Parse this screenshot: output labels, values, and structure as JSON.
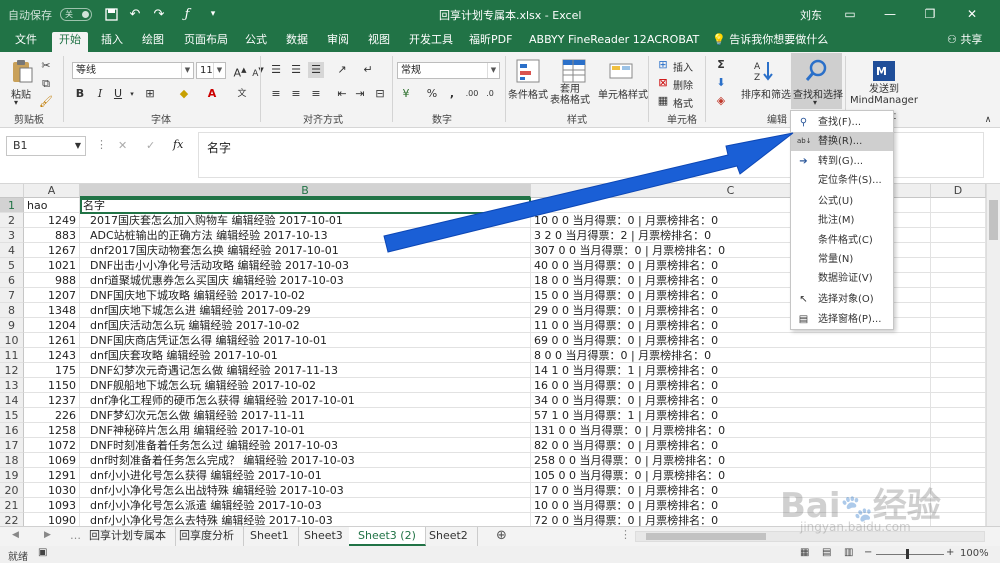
{
  "title_bar": {
    "autosave_label": "自动保存",
    "autosave_state": "关",
    "window_title": "回享计划专属本.xlsx - Excel",
    "user": "刘东",
    "share": "共享"
  },
  "tabs": [
    "文件",
    "开始",
    "插入",
    "绘图",
    "页面布局",
    "公式",
    "数据",
    "审阅",
    "视图",
    "开发工具",
    "福昕PDF",
    "ABBYY FineReader 12",
    "ACROBAT"
  ],
  "tell_me": "告诉我你想要做什么",
  "ribbon": {
    "clipboard": {
      "paste": "粘贴",
      "label": "剪贴板"
    },
    "font": {
      "name": "等线",
      "size": "11",
      "label": "字体"
    },
    "alignment": {
      "label": "对齐方式"
    },
    "number": {
      "format": "常规",
      "label": "数字"
    },
    "styles": {
      "conditional": "条件格式",
      "table": "套用\n表格格式",
      "cell": "单元格样式",
      "label": "样式"
    },
    "cells": {
      "insert": "插入",
      "delete": "删除",
      "format": "格式",
      "label": "单元格"
    },
    "editing": {
      "sort": "排序和筛选",
      "find": "查找和选择",
      "label": "编辑"
    },
    "mindmanager": {
      "send": "发送到\nMindManager",
      "label": "et"
    }
  },
  "formula_bar": {
    "name_box": "B1",
    "fx": "fx",
    "content": "名字"
  },
  "columns": [
    {
      "label": "A"
    },
    {
      "label": "B"
    },
    {
      "label": "C"
    },
    {
      "label": "D"
    }
  ],
  "rows": [
    {
      "n": "1",
      "a": "hao",
      "b": "名字",
      "c": "数据"
    },
    {
      "n": "2",
      "a": "1249",
      "b": "2017国庆套怎么加入购物车 编辑经验 2017-10-01",
      "c": "10 0 0 当月得票：0 | 月票榜排名：0"
    },
    {
      "n": "3",
      "a": "883",
      "b": "ADC站桩输出的正确方法 编辑经验 2017-10-13",
      "c": "3 2 0 当月得票：2 | 月票榜排名：0"
    },
    {
      "n": "4",
      "a": "1267",
      "b": "dnf2017国庆动物套怎么换 编辑经验 2017-10-01",
      "c": "307 0 0 当月得票：0 | 月票榜排名：0"
    },
    {
      "n": "5",
      "a": "1021",
      "b": "DNF出击小小净化号活动攻略 编辑经验 2017-10-03",
      "c": "40 0 0 当月得票：0 | 月票榜排名：0"
    },
    {
      "n": "6",
      "a": "988",
      "b": "dnf道聚城优惠券怎么买国庆 编辑经验 2017-10-03",
      "c": "18 0 0 当月得票：0 | 月票榜排名：0"
    },
    {
      "n": "7",
      "a": "1207",
      "b": "DNF国庆地下城攻略 编辑经验 2017-10-02",
      "c": "15 0 0 当月得票：0 | 月票榜排名：0"
    },
    {
      "n": "8",
      "a": "1348",
      "b": "dnf国庆地下城怎么进 编辑经验 2017-09-29",
      "c": "29 0 0 当月得票：0 | 月票榜排名：0"
    },
    {
      "n": "9",
      "a": "1204",
      "b": "dnf国庆活动怎么玩 编辑经验 2017-10-02",
      "c": "11 0 0 当月得票：0 | 月票榜排名：0"
    },
    {
      "n": "10",
      "a": "1261",
      "b": "DNF国庆商店凭证怎么得 编辑经验 2017-10-01",
      "c": "69 0 0 当月得票：0 | 月票榜排名：0"
    },
    {
      "n": "11",
      "a": "1243",
      "b": "dnf国庆套攻略 编辑经验 2017-10-01",
      "c": "8 0 0 当月得票：0 | 月票榜排名：0"
    },
    {
      "n": "12",
      "a": "175",
      "b": "DNF幻梦次元奇遇记怎么做 编辑经验 2017-11-13",
      "c": "14 1 0 当月得票：1 | 月票榜排名：0"
    },
    {
      "n": "13",
      "a": "1150",
      "b": "DNF舰船地下城怎么玩 编辑经验 2017-10-02",
      "c": "16 0 0 当月得票：0 | 月票榜排名：0"
    },
    {
      "n": "14",
      "a": "1237",
      "b": "dnf净化工程师的硬币怎么获得 编辑经验 2017-10-01",
      "c": "34 0 0 当月得票：0 | 月票榜排名：0"
    },
    {
      "n": "15",
      "a": "226",
      "b": "DNF梦幻次元怎么做 编辑经验 2017-11-11",
      "c": "57 1 0 当月得票：1 | 月票榜排名：0"
    },
    {
      "n": "16",
      "a": "1258",
      "b": "DNF神秘碎片怎么用 编辑经验 2017-10-01",
      "c": "131 0 0 当月得票：0 | 月票榜排名：0"
    },
    {
      "n": "17",
      "a": "1072",
      "b": "DNF时刻准备着任务怎么过 编辑经验 2017-10-03",
      "c": "82 0 0 当月得票：0 | 月票榜排名：0"
    },
    {
      "n": "18",
      "a": "1069",
      "b": "dnf时刻准备着任务怎么完成？ 编辑经验 2017-10-03",
      "c": "258 0 0 当月得票：0 | 月票榜排名：0"
    },
    {
      "n": "19",
      "a": "1291",
      "b": "dnf小小进化号怎么获得 编辑经验 2017-10-01",
      "c": "105 0 0 当月得票：0 | 月票榜排名：0"
    },
    {
      "n": "20",
      "a": "1030",
      "b": "dnf小小净化号怎么出战特殊 编辑经验 2017-10-03",
      "c": "17 0 0 当月得票：0 | 月票榜排名：0"
    },
    {
      "n": "21",
      "a": "1093",
      "b": "dnf小小净化号怎么派遣 编辑经验 2017-10-03",
      "c": "10 0 0 当月得票：0 | 月票榜排名：0"
    },
    {
      "n": "22",
      "a": "1090",
      "b": "dnf小小净化号怎么去特殊 编辑经验 2017-10-03",
      "c": "72 0 0 当月得票：0 | 月票榜排名：0"
    }
  ],
  "sheets": [
    "回享计划专属本",
    "回享度分析",
    "Sheet1",
    "Sheet3",
    "Sheet3 (2)",
    "Sheet2"
  ],
  "active_sheet": "Sheet3 (2)",
  "status": {
    "mode": "就绪",
    "zoom": "100%"
  },
  "find_menu": [
    "查找(F)...",
    "替换(R)...",
    "转到(G)...",
    "定位条件(S)...",
    "公式(U)",
    "批注(M)",
    "条件格式(C)",
    "常量(N)",
    "数据验证(V)",
    "选择对象(O)",
    "选择窗格(P)..."
  ],
  "watermark": {
    "brand": "Bai",
    "brand2": "经验",
    "url": "jingyan.baidu.com"
  },
  "colors": {
    "excel_green": "#217346",
    "arrow_blue": "#1a5fd6",
    "menu_hover": "#cfcfcf"
  }
}
